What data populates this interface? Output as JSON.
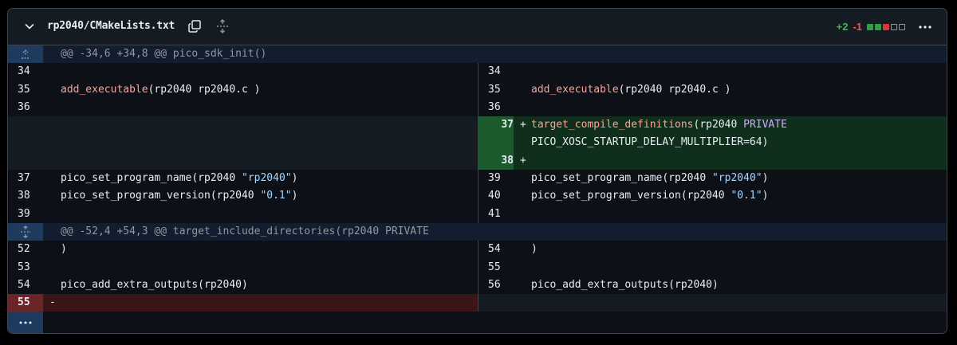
{
  "header": {
    "filename": "rp2040/CMakeLists.txt",
    "additions": "+2",
    "deletions": "-1",
    "colors": {
      "add": "#3fb950",
      "del": "#f85149"
    },
    "icons": [
      "chevron-down-icon",
      "copy-icon",
      "expand-icon",
      "kebab-icon"
    ]
  },
  "hunks": [
    {
      "text": "@@ -34,6 +34,8 @@ pico_sdk_init()"
    },
    {
      "text": "@@ -52,4 +54,3 @@ target_include_directories(rp2040 PRIVATE"
    }
  ],
  "lines": {
    "l34": "34",
    "l35": "35",
    "l36": "36",
    "l37": "37",
    "l38": "38",
    "l39": "39",
    "r34": "34",
    "r35": "35",
    "r36": "36",
    "r37": "37",
    "r38": "38",
    "r39": "39",
    "r40": "40",
    "r41": "41",
    "l52": "52",
    "l53": "53",
    "l54": "54",
    "l55": "55",
    "r54": "54",
    "r55": "55",
    "r56": "56"
  },
  "code": {
    "add_exec_fn": "add_executable",
    "add_exec_args": "(rp2040 rp2040.c )",
    "tcd_fn": "target_compile_definitions",
    "tcd_args": "(rp2040 ",
    "tcd_private": "PRIVATE",
    "tcd_cont": "PICO_XOSC_STARTUP_DELAY_MULTIPLIER=64)",
    "spn_fn": "pico_set_program_name(rp2040 ",
    "spn_str": "\"rp2040\"",
    "spn_end": ")",
    "spv_fn": "pico_set_program_version(rp2040 ",
    "spv_str": "\"0.1\"",
    "spv_end": ")",
    "close_paren": ")",
    "extra": "pico_add_extra_outputs(rp2040)",
    "plus": "+",
    "minus": "-"
  }
}
